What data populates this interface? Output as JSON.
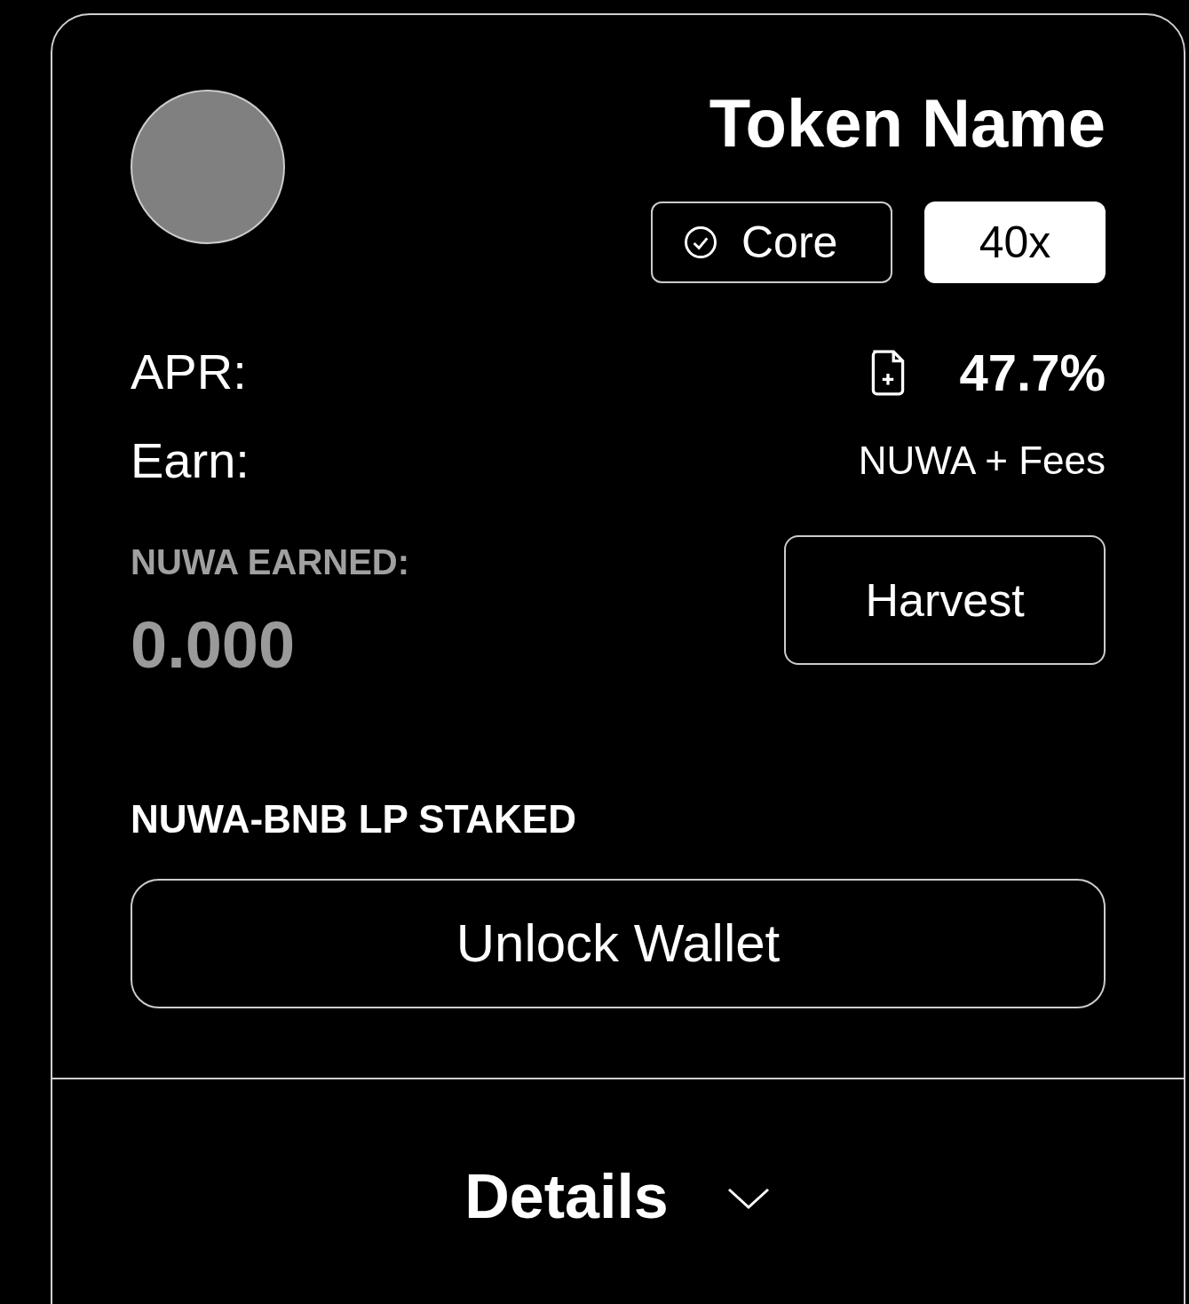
{
  "card": {
    "title": "Token Name",
    "badges": [
      {
        "kind": "verified",
        "label": "Core"
      },
      {
        "kind": "multiplier",
        "label": "40x"
      }
    ],
    "rows": [
      {
        "label": "APR:",
        "value": "47.7%",
        "kind": "apr"
      },
      {
        "label": "Earn:",
        "value": "NUWA + Fees",
        "kind": "earn"
      }
    ],
    "earned": {
      "label": "NUWA EARNED:",
      "value": "0.000",
      "button": "Harvest"
    },
    "staked": {
      "label": "NUWA-BNB LP STAKED",
      "button": "Unlock Wallet"
    },
    "details": {
      "label": "Details",
      "expanded": false
    }
  }
}
